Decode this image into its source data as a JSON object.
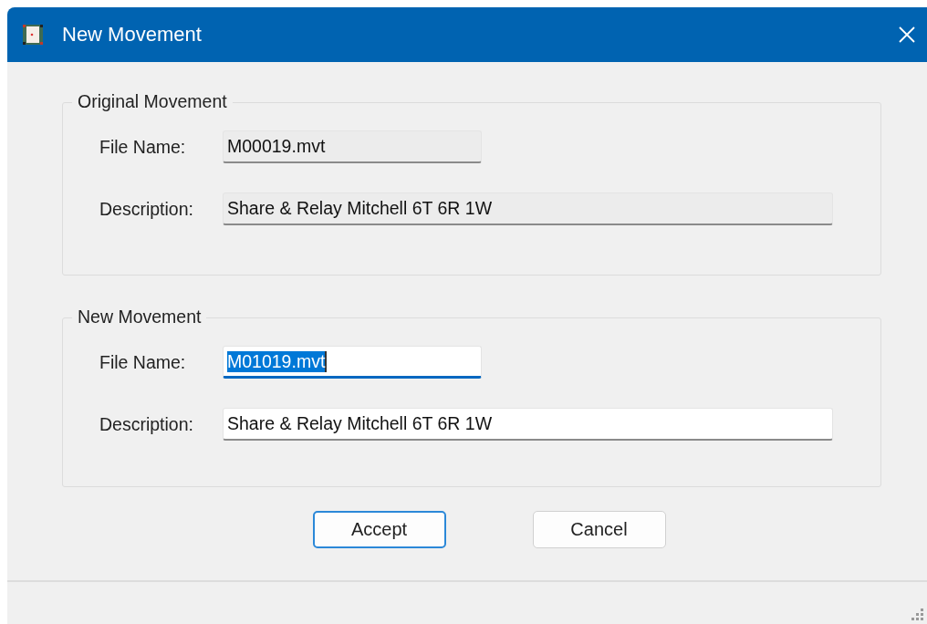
{
  "window": {
    "title": "New Movement"
  },
  "groups": [
    {
      "title": "Original Movement",
      "fields": [
        {
          "label": "File Name:",
          "value": "M00019.mvt",
          "kind": "short",
          "read_only": true,
          "focused": false,
          "text_selected": false
        },
        {
          "label": "Description:",
          "value": "Share & Relay Mitchell 6T 6R 1W",
          "kind": "long",
          "read_only": true,
          "focused": false,
          "text_selected": false
        }
      ]
    },
    {
      "title": "New Movement",
      "fields": [
        {
          "label": "File Name:",
          "value": "M01019.mvt",
          "kind": "short",
          "read_only": false,
          "focused": true,
          "text_selected": true
        },
        {
          "label": "Description:",
          "value": "Share & Relay Mitchell 6T 6R 1W",
          "kind": "long",
          "read_only": false,
          "focused": false,
          "text_selected": false
        }
      ]
    }
  ],
  "buttons": [
    {
      "label": "Accept",
      "default": true
    },
    {
      "label": "Cancel",
      "default": false
    }
  ]
}
